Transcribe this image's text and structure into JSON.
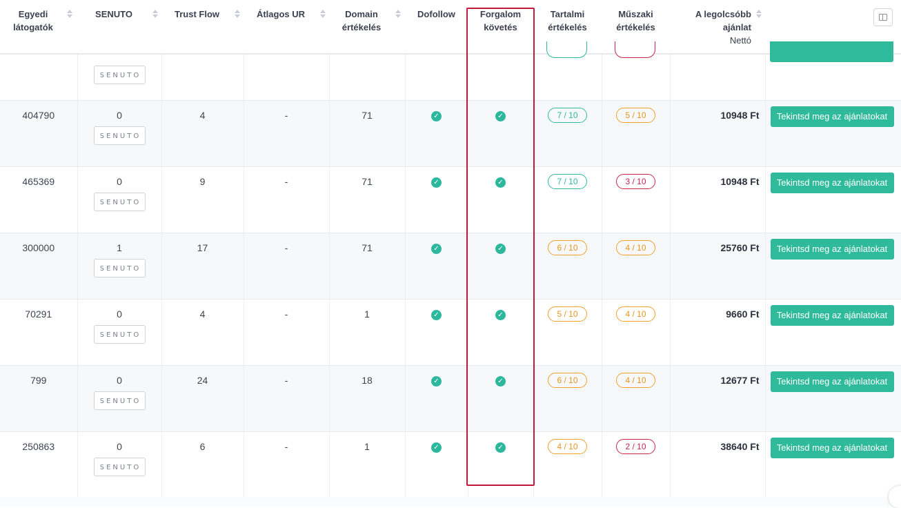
{
  "header": {
    "unique_visitors": "Egyedi látogatók",
    "senuto": "SENUTO",
    "trust_flow": "Trust Flow",
    "avg_ur": "Átlagos UR",
    "domain_rating": "Domain értékelés",
    "dofollow": "Dofollow",
    "traffic_tracking": "Forgalom követés",
    "content_rating": "Tartalmi értékelés",
    "technical_rating": "Műszaki értékelés",
    "lowest_offer": "A legolcsóbb ajánlat",
    "lowest_offer_sub": "Nettó"
  },
  "senuto_badge_text": "SENUTO",
  "offer_button_label": "Tekintsd meg az ajánlatokat",
  "rows": [
    {
      "visitors": "404790",
      "senuto": "0",
      "trust_flow": "4",
      "avg_ur": "-",
      "domain_rating": "71",
      "content": "7 / 10",
      "technical": "5 / 10",
      "price": "10948 Ft"
    },
    {
      "visitors": "465369",
      "senuto": "0",
      "trust_flow": "9",
      "avg_ur": "-",
      "domain_rating": "71",
      "content": "7 / 10",
      "technical": "3 / 10",
      "price": "10948 Ft"
    },
    {
      "visitors": "300000",
      "senuto": "1",
      "trust_flow": "17",
      "avg_ur": "-",
      "domain_rating": "71",
      "content": "6 / 10",
      "technical": "4 / 10",
      "price": "25760 Ft"
    },
    {
      "visitors": "70291",
      "senuto": "0",
      "trust_flow": "4",
      "avg_ur": "-",
      "domain_rating": "1",
      "content": "5 / 10",
      "technical": "4 / 10",
      "price": "9660 Ft"
    },
    {
      "visitors": "799",
      "senuto": "0",
      "trust_flow": "24",
      "avg_ur": "-",
      "domain_rating": "18",
      "content": "6 / 10",
      "technical": "4 / 10",
      "price": "12677 Ft"
    },
    {
      "visitors": "250863",
      "senuto": "0",
      "trust_flow": "6",
      "avg_ur": "-",
      "domain_rating": "1",
      "content": "4 / 10",
      "technical": "2 / 10",
      "price": "38640 Ft"
    }
  ],
  "colors": {
    "accent_green": "#2fbb9b",
    "pill_orange": "#f0a030",
    "pill_red": "#c8264a",
    "highlight_red": "#c1183c"
  },
  "icons": [
    "check-circle-icon",
    "columns-toggle-icon",
    "sort-icon"
  ]
}
